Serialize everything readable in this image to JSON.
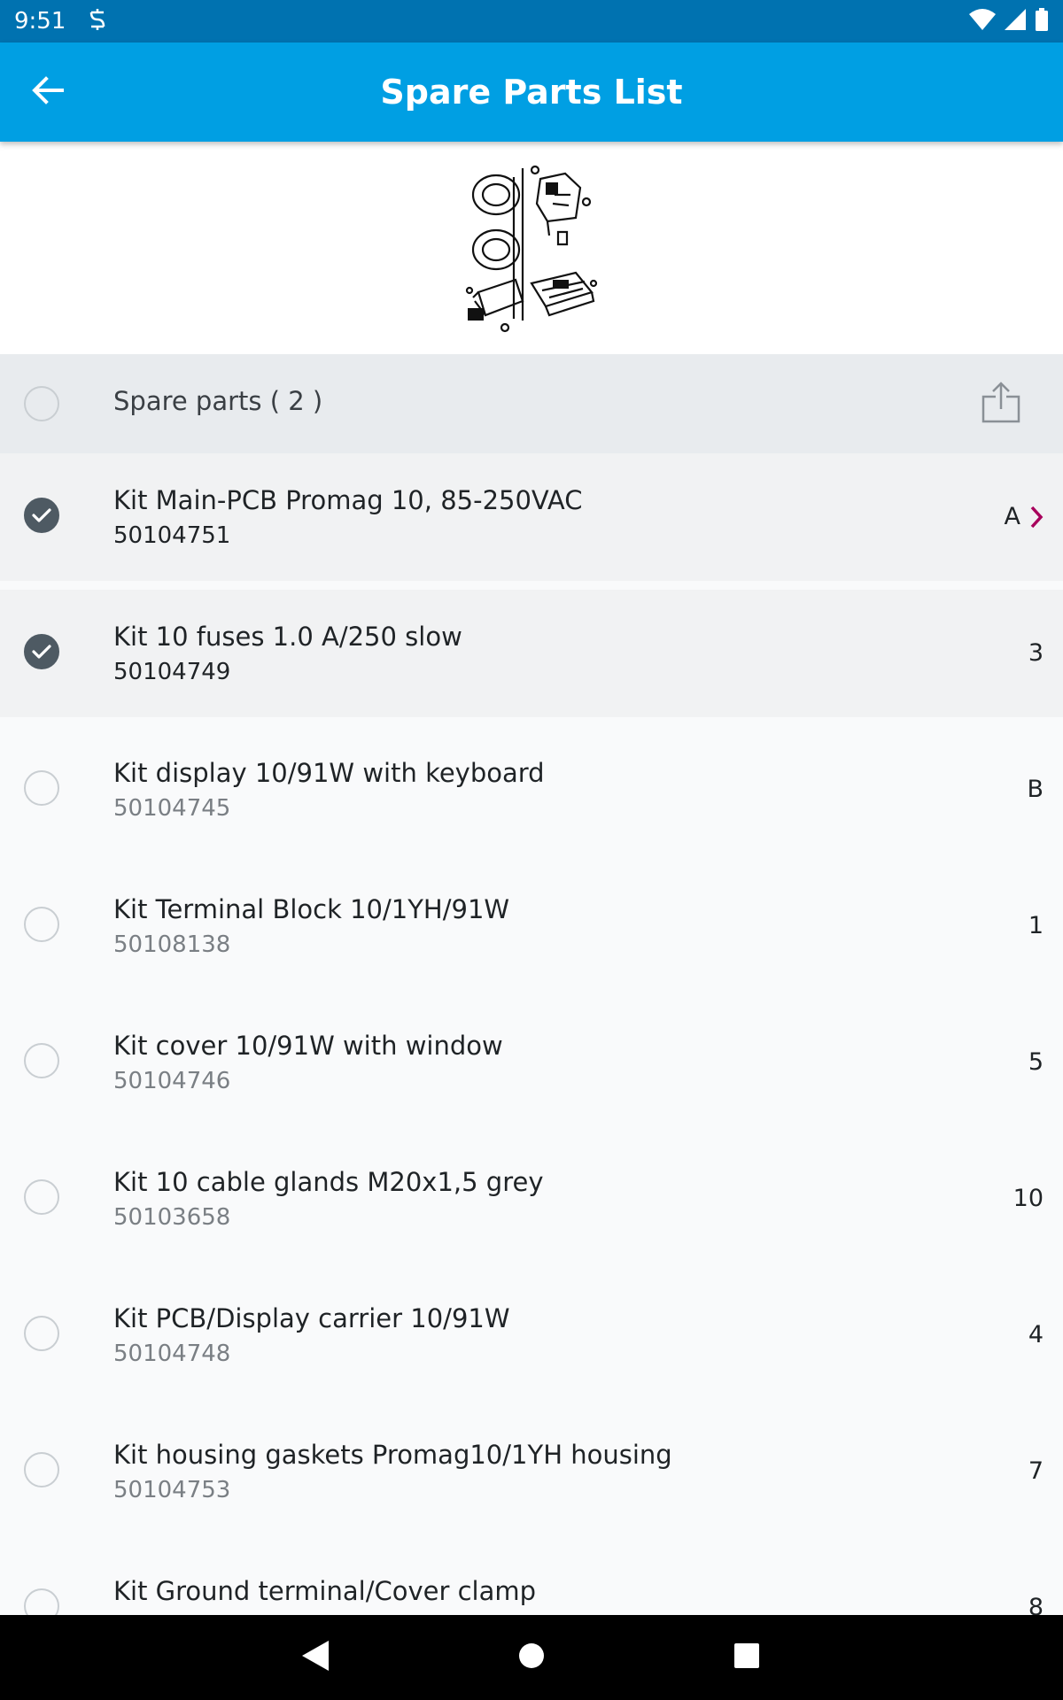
{
  "status_bar": {
    "time": "9:51",
    "left_icon": "sync-icon",
    "right_icons": [
      "wifi-icon",
      "signal-icon",
      "battery-icon"
    ]
  },
  "app_bar": {
    "title": "Spare Parts List",
    "back_icon": "arrow-back-icon"
  },
  "list_header": {
    "label": "Spare parts ( 2 )",
    "share_icon": "share-icon"
  },
  "parts": [
    {
      "name": "Kit Main-PCB Promag 10, 85-250VAC",
      "number": "50104751",
      "qty": "A",
      "selected": true,
      "has_link": true
    },
    {
      "name": "Kit 10 fuses 1.0 A/250 slow",
      "number": "50104749",
      "qty": "3",
      "selected": true,
      "has_link": false
    },
    {
      "name": "Kit display 10/91W with keyboard",
      "number": "50104745",
      "qty": "B",
      "selected": false,
      "has_link": false
    },
    {
      "name": "Kit Terminal Block 10/1YH/91W",
      "number": "50108138",
      "qty": "1",
      "selected": false,
      "has_link": false
    },
    {
      "name": "Kit cover 10/91W with window",
      "number": "50104746",
      "qty": "5",
      "selected": false,
      "has_link": false
    },
    {
      "name": "Kit 10 cable glands M20x1,5 grey",
      "number": "50103658",
      "qty": "10",
      "selected": false,
      "has_link": false
    },
    {
      "name": "Kit PCB/Display carrier 10/91W",
      "number": "50104748",
      "qty": "4",
      "selected": false,
      "has_link": false
    },
    {
      "name": "Kit housing gaskets Promag10/1YH housing",
      "number": "50104753",
      "qty": "7",
      "selected": false,
      "has_link": false
    },
    {
      "name": "Kit Ground terminal/Cover clamp",
      "number": "",
      "qty": "8",
      "selected": false,
      "has_link": false
    }
  ],
  "colors": {
    "status_bar": "#0072b0",
    "app_bar": "#009fe3",
    "check": "#4e5a63",
    "accent_chevron": "#a8005c"
  },
  "nav_bar": {
    "icons": [
      "back-triangle-icon",
      "home-circle-icon",
      "recents-square-icon"
    ]
  }
}
